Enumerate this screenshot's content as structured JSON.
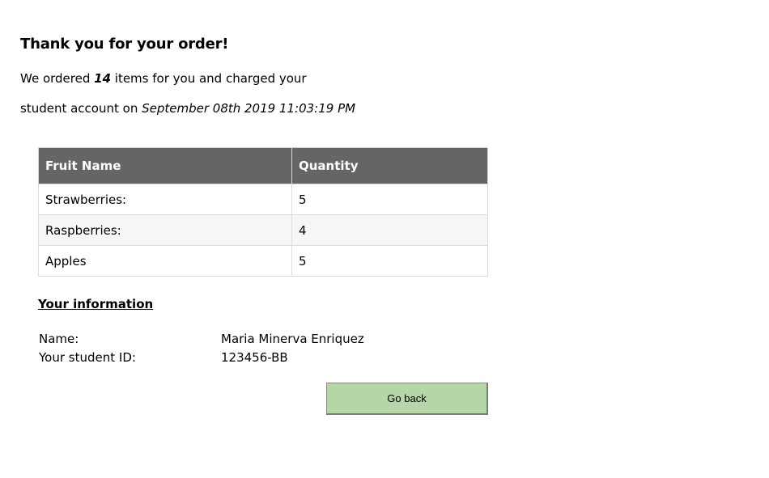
{
  "heading": "Thank you for your order!",
  "confirmation": {
    "line1_prefix": "We ordered ",
    "item_count": "14",
    "line1_suffix": " items for you and charged your",
    "line2_prefix": "student account on ",
    "datetime": "September 08th 2019 11:03:19 PM"
  },
  "order_table": {
    "headers": [
      "Fruit Name",
      "Quantity"
    ],
    "rows": [
      {
        "fruit": "Strawberries:",
        "quantity": "5"
      },
      {
        "fruit": "Raspberries:",
        "quantity": "4"
      },
      {
        "fruit": "Apples",
        "quantity": "5"
      }
    ],
    "header_color": "#646663"
  },
  "your_information": {
    "title": "Your information",
    "name_label": "Name:",
    "name_value": "Maria Minerva Enriquez",
    "student_id_label": "Your student ID:",
    "student_id_value": "123456-BB"
  },
  "go_back_button": {
    "label": "Go back",
    "color": "#b5d6a7"
  }
}
